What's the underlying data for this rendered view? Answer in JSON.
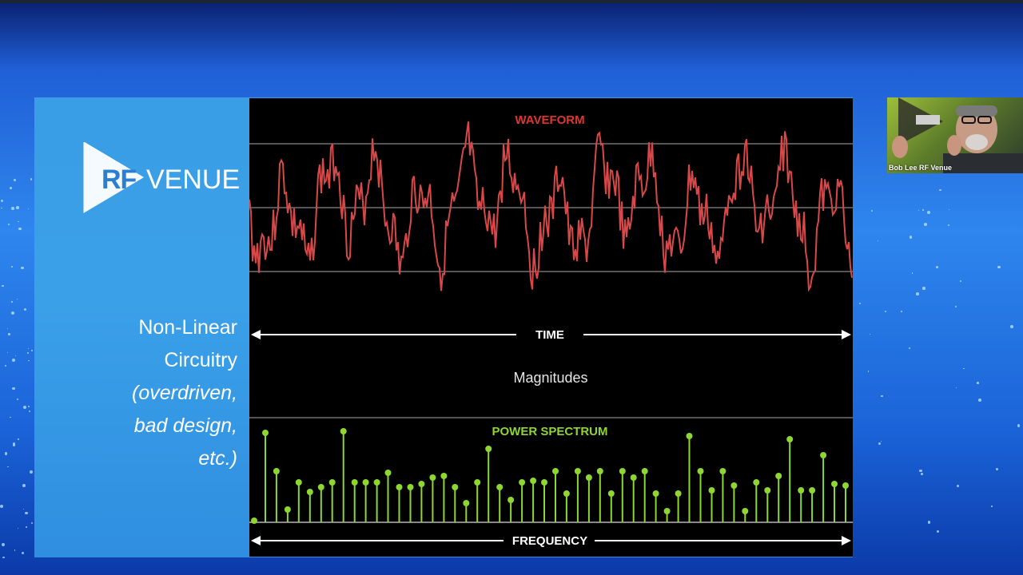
{
  "slide": {
    "logo": {
      "rf": "RF",
      "venue": "VENUE"
    },
    "side_text": {
      "line1": "Non-Linear",
      "line2": "Circuitry",
      "line3": "(overdriven,",
      "line4": "bad design,",
      "line5": "etc.)"
    },
    "panel": {
      "waveform_title": "WAVEFORM",
      "time_label": "TIME",
      "magnitudes_label": "Magnitudes",
      "spectrum_title": "POWER SPECTRUM",
      "frequency_label": "FREQUENCY",
      "waveform_color": "#d84848",
      "spectrum_color": "#8fd630",
      "title_red": "#e2342f"
    }
  },
  "webcam": {
    "name": "Bob Lee RF Venue"
  }
}
